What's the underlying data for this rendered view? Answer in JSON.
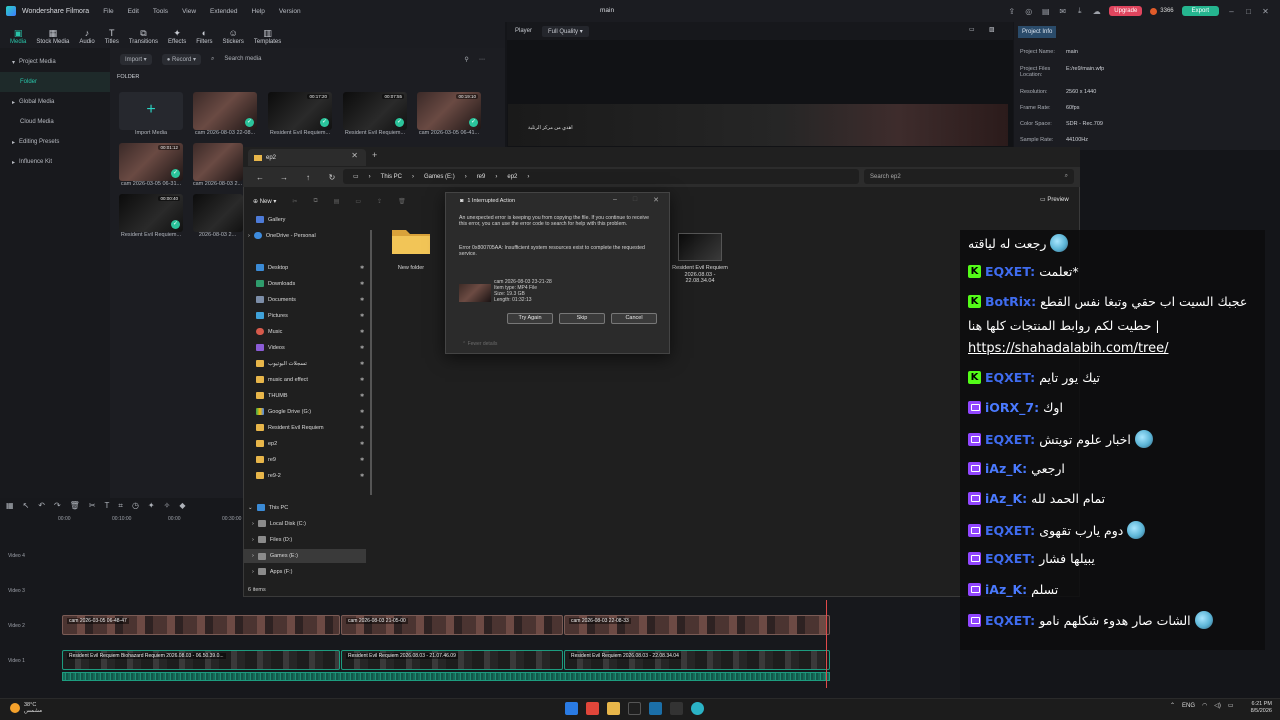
{
  "filmora": {
    "app_name": "Wondershare Filmora",
    "menu": [
      "File",
      "Edit",
      "Tools",
      "View",
      "Extended",
      "Help",
      "Version"
    ],
    "project_title": "main",
    "upgrade": "Upgrade",
    "credits": "3366",
    "export": "Export",
    "tools": [
      "Media",
      "Stock Media",
      "Audio",
      "Titles",
      "Transitions",
      "Effects",
      "Filters",
      "Stickers",
      "Templates"
    ],
    "sidebar": [
      "Project Media",
      "Folder",
      "Global Media",
      "Cloud Media",
      "Editing Presets",
      "Influence Kit"
    ],
    "media_bar": {
      "import": "Import",
      "record": "Record",
      "search": "Search media"
    },
    "folder_label": "FOLDER",
    "import_media": "Import Media",
    "media_items": [
      {
        "label": "cam 2026-08-03 22-08...",
        "dur": ""
      },
      {
        "label": "Resident Evil Requiem...",
        "dur": "00:17:20"
      },
      {
        "label": "Resident Evil Requiem...",
        "dur": "00:07:55"
      },
      {
        "label": "cam 2026-03-05 06-41...",
        "dur": "00:19:10"
      },
      {
        "label": "cam 2026-03-05 06-31...",
        "dur": "00:01:12"
      },
      {
        "label": "cam 2026-08-03 2...",
        "dur": ""
      },
      {
        "label": "Resident Evil Requiem...",
        "dur": "00:00:40"
      },
      {
        "label": "2026-08-03 2...",
        "dur": ""
      }
    ],
    "player": {
      "label": "Player",
      "quality": "Full Quality",
      "overlay_text": "اهدي من مركز الرتلية"
    },
    "project_info": {
      "tab": "Project Info",
      "rows": [
        {
          "k": "Project Name:",
          "v": "main"
        },
        {
          "k": "Project Files Location:",
          "v": "E:/re9/main.wfp"
        },
        {
          "k": "Resolution:",
          "v": "2560 x 1440"
        },
        {
          "k": "Frame Rate:",
          "v": "60fps"
        },
        {
          "k": "Color Space:",
          "v": "SDR - Rec.709"
        },
        {
          "k": "Sample Rate:",
          "v": "44100Hz"
        }
      ]
    },
    "timeline": {
      "ruler": [
        "00:00",
        "00:10:00",
        "00:00",
        "00:30:00"
      ],
      "tracks": [
        "Video 4",
        "Video 3",
        "Video 2",
        "Video 1"
      ],
      "clips_top": [
        "cam 2026-03-05 06-48-47",
        "cam 2026-08-03 21-05-00",
        "cam 2026-08-03 22-08-33"
      ],
      "clips_bottom": [
        "Resident Evil Requiem Biohazard Requiem 2026.08.03 - 06.50.39.0...",
        "Resident Evil Requiem 2026.08.03 - 21.07.46.09",
        "Resident Evil Requiem 2026.08.03 - 22.08.34.04"
      ]
    }
  },
  "explorer": {
    "tab": "ep2",
    "breadcrumb": [
      "This PC",
      "Games (E:)",
      "re9",
      "ep2"
    ],
    "search": "Search ep2",
    "new": "New",
    "preview": "Preview",
    "nav": [
      {
        "label": "Gallery"
      },
      {
        "label": "OneDrive - Personal"
      },
      {
        "label": "Desktop"
      },
      {
        "label": "Downloads"
      },
      {
        "label": "Documents"
      },
      {
        "label": "Pictures"
      },
      {
        "label": "Music"
      },
      {
        "label": "Videos"
      },
      {
        "label": "تسجلات البوتيوب"
      },
      {
        "label": "music and effect"
      },
      {
        "label": "THUMB"
      },
      {
        "label": "Google Drive (G:)"
      },
      {
        "label": "Resident Evil Requiem"
      },
      {
        "label": "ep2"
      },
      {
        "label": "re9"
      },
      {
        "label": "re9-2"
      },
      {
        "label": "This PC"
      },
      {
        "label": "Local Disk (C:)"
      },
      {
        "label": "Files (D:)"
      },
      {
        "label": "Games (E:)"
      },
      {
        "label": "Apps (F:)"
      }
    ],
    "items": {
      "folder": "New folder",
      "video": "Resident Evil Requiem 2026.08.03 - 22.08.34.04"
    },
    "status": "6 items"
  },
  "dialog": {
    "title": "1 Interrupted Action",
    "message": "An unexpected error is keeping you from copying the file. If you continue to receive this error, you can use the error code to search for help with this problem.",
    "error": "Error 0x800705AA: Insufficient system resources exist to complete the requested service.",
    "file_name": "cam 2026-08-03 23-21-28",
    "file_type": "Item type: MP4 File",
    "file_size": "Size: 19.3 GB",
    "file_length": "Length: 01:32:13",
    "try_again": "Try Again",
    "skip": "Skip",
    "cancel": "Cancel",
    "fewer": "Fewer details"
  },
  "chat": [
    {
      "badge": "",
      "user": "",
      "text": "رجعت له لياقته",
      "emote": true
    },
    {
      "badge": "kick",
      "user": "EQXET:",
      "text": "*تعلمت",
      "emote": false
    },
    {
      "badge": "kick",
      "user": "BotRix:",
      "text": "عجبك السيت اب حقي وتبغا نفس القطع",
      "emote": false
    },
    {
      "badge": "",
      "user": "",
      "text": "| حطيت لكم روابط المنتجات كلها هنا",
      "emote": false
    },
    {
      "badge": "",
      "user": "",
      "text": "https://shahadalabih.com/tree/",
      "emote": false
    },
    {
      "badge": "kick",
      "user": "EQXET:",
      "text": "تيك يور تايم",
      "emote": false
    },
    {
      "badge": "twitch",
      "user": "iORX_7:",
      "text": "اوك",
      "emote": false
    },
    {
      "badge": "twitch",
      "user": "EQXET:",
      "text": "اخبار علوم تويتش",
      "emote": true
    },
    {
      "badge": "twitch",
      "user": "iAz_K:",
      "text": "ارجعي",
      "emote": false
    },
    {
      "badge": "twitch",
      "user": "iAz_K:",
      "text": "تمام الحمد لله",
      "emote": false
    },
    {
      "badge": "twitch",
      "user": "EQXET:",
      "text": "دوم يارب تقهوى",
      "emote": true
    },
    {
      "badge": "twitch",
      "user": "EQXET:",
      "text": "يبيلها فشار",
      "emote": false
    },
    {
      "badge": "twitch",
      "user": "iAz_K:",
      "text": "تسلم",
      "emote": false
    },
    {
      "badge": "twitch",
      "user": "EQXET:",
      "text": "الشات صار هدوء شكلهم نامو",
      "emote": true
    }
  ],
  "taskbar": {
    "temp": "38°C",
    "weather": "مشمس",
    "lang": "ENG",
    "time": "6:21 PM",
    "date": "8/5/2026"
  }
}
